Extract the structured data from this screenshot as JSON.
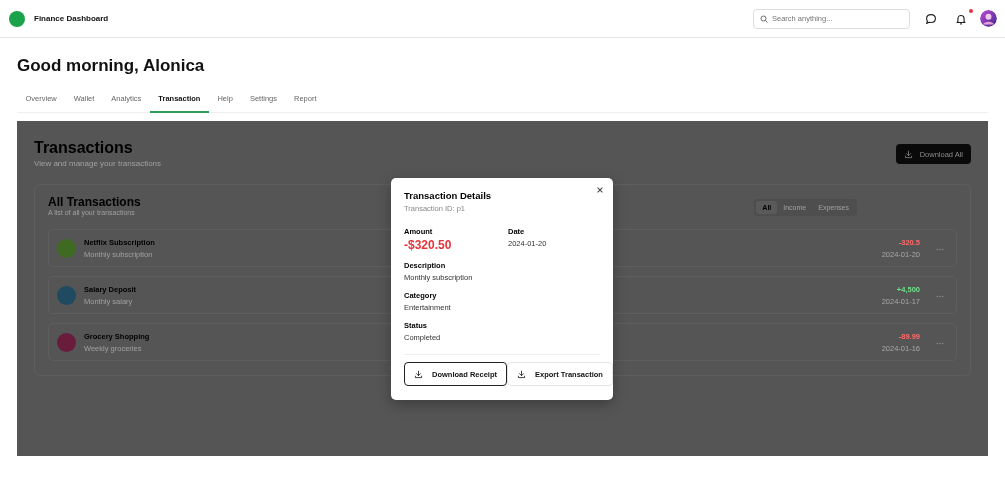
{
  "header": {
    "title": "Finance Dashboard",
    "search": {
      "placeholder": "Search anything..."
    },
    "notifications": {
      "unread": true
    }
  },
  "greeting": "Good morning, Alonica",
  "tabs": [
    {
      "label": "Overview",
      "selected": false
    },
    {
      "label": "Wallet",
      "selected": false
    },
    {
      "label": "Analytics",
      "selected": false
    },
    {
      "label": "Transaction",
      "selected": true
    },
    {
      "label": "Help",
      "selected": false
    },
    {
      "label": "Settings",
      "selected": false
    },
    {
      "label": "Report",
      "selected": false
    }
  ],
  "page": {
    "title": "Transactions",
    "subtitle": "View and manage your transactions",
    "download_button": "Download All"
  },
  "list": {
    "title": "All Transactions",
    "subtitle": "A list of all your transactions",
    "filters": [
      {
        "label": "All",
        "selected": true
      },
      {
        "label": "Income",
        "selected": false
      },
      {
        "label": "Expenses",
        "selected": false
      }
    ],
    "rows": [
      {
        "name": "Netflix Subscription",
        "note": "Monthly subscription",
        "amount": "-320.5",
        "kind": "expense",
        "date": "2024-01-20",
        "color": "#3e6a22"
      },
      {
        "name": "Salary Deposit",
        "note": "Monthly salary",
        "amount": "+4,500",
        "kind": "income",
        "date": "2024-01-17",
        "color": "#1f4a60"
      },
      {
        "name": "Grocery Shopping",
        "note": "Weekly groceries",
        "amount": "-89.99",
        "kind": "expense",
        "date": "2024-01-16",
        "color": "#6a1c3c"
      }
    ]
  },
  "modal": {
    "title": "Transaction Details",
    "subtitle": "Transaction ID: p1",
    "fields": [
      {
        "label": "Amount",
        "value": "-$320.50",
        "kind": "amount"
      },
      {
        "label": "Date",
        "value": "2024-01-20",
        "kind": "text"
      },
      {
        "label": "Description",
        "value": "Monthly subscription",
        "kind": "text"
      },
      {
        "label": "Category",
        "value": "Entertainment",
        "kind": "text"
      },
      {
        "label": "Status",
        "value": "Completed",
        "kind": "text"
      }
    ],
    "buttons": [
      {
        "label": "Download Receipt",
        "focused": true
      },
      {
        "label": "Export Transaction",
        "focused": false
      }
    ]
  }
}
